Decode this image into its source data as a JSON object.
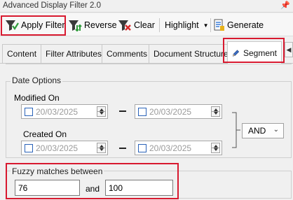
{
  "window": {
    "title": "Advanced Display Filter 2.0",
    "pin_glyph": "📌"
  },
  "toolbar": {
    "apply_label": "Apply Filter",
    "reverse_label": "Reverse",
    "clear_label": "Clear",
    "highlight_label": "Highlight",
    "generate_label": "Generate"
  },
  "tabs": [
    {
      "label": "Content"
    },
    {
      "label": "Filter Attributes"
    },
    {
      "label": "Comments"
    },
    {
      "label": "Document Structure"
    },
    {
      "label": "Segment"
    }
  ],
  "tab_scroll_glyph": "◀",
  "date_options": {
    "legend": "Date Options",
    "modified_label": "Modified On",
    "created_label": "Created On",
    "modified_from": "20/03/2025",
    "modified_to": "20/03/2025",
    "created_from": "20/03/2025",
    "created_to": "20/03/2025",
    "operator": "AND"
  },
  "fuzzy": {
    "legend": "Fuzzy matches between",
    "min": "76",
    "and_label": "and",
    "max": "100"
  },
  "colors": {
    "highlight_red": "#d8192f",
    "checkbox_blue": "#2a62b8"
  }
}
